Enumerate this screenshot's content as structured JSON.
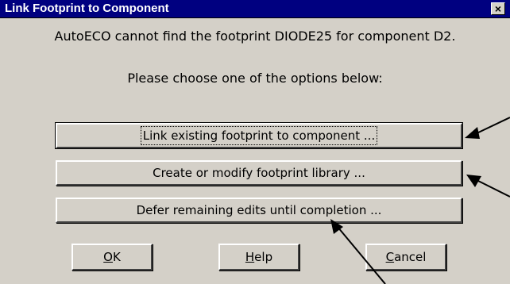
{
  "window": {
    "title": "Link Footprint to Component",
    "close_glyph": "×"
  },
  "message": {
    "line1": "AutoECO cannot find the footprint DIODE25 for component D2.",
    "line2": "Please choose one of the options below:"
  },
  "options": {
    "link_label": "Link existing footprint to component ...",
    "create_label": "Create or modify footprint library ...",
    "defer_label": "Defer remaining edits until completion ..."
  },
  "buttons": {
    "ok_mnemonic": "O",
    "ok_rest": "K",
    "help_mnemonic": "H",
    "help_rest": "elp",
    "cancel_mnemonic": "C",
    "cancel_rest": "ancel"
  }
}
